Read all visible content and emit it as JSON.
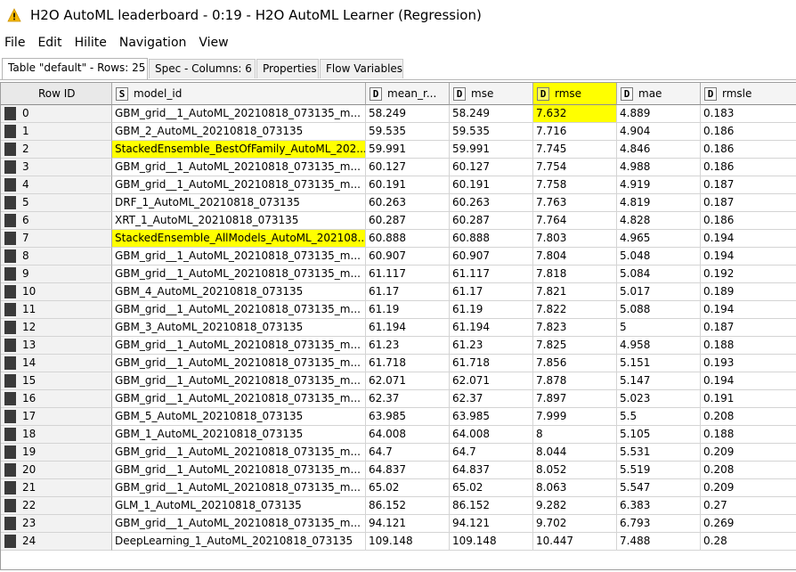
{
  "window": {
    "title": "H2O AutoML leaderboard - 0:19 - H2O AutoML Learner (Regression)",
    "icon": "warning-triangle-icon",
    "icon_color": "#f5b800"
  },
  "menu": [
    "File",
    "Edit",
    "Hilite",
    "Navigation",
    "View"
  ],
  "tabs": [
    "Table \"default\" - Rows: 25",
    "Spec - Columns: 6",
    "Properties",
    "Flow Variables"
  ],
  "highlight_color": "#ffff00",
  "table": {
    "rowid_header": "Row ID",
    "columns": [
      {
        "type": "S",
        "name": "model_id"
      },
      {
        "type": "D",
        "name": "mean_r..."
      },
      {
        "type": "D",
        "name": "mse"
      },
      {
        "type": "D",
        "name": "rmse"
      },
      {
        "type": "D",
        "name": "mae"
      },
      {
        "type": "D",
        "name": "rmsle"
      }
    ],
    "rows": [
      [
        "0",
        "GBM_grid__1_AutoML_20210818_073135_m...",
        "58.249",
        "58.249",
        "7.632",
        "4.889",
        "0.183"
      ],
      [
        "1",
        "GBM_2_AutoML_20210818_073135",
        "59.535",
        "59.535",
        "7.716",
        "4.904",
        "0.186"
      ],
      [
        "2",
        "StackedEnsemble_BestOfFamily_AutoML_202...",
        "59.991",
        "59.991",
        "7.745",
        "4.846",
        "0.186"
      ],
      [
        "3",
        "GBM_grid__1_AutoML_20210818_073135_m...",
        "60.127",
        "60.127",
        "7.754",
        "4.988",
        "0.186"
      ],
      [
        "4",
        "GBM_grid__1_AutoML_20210818_073135_m...",
        "60.191",
        "60.191",
        "7.758",
        "4.919",
        "0.187"
      ],
      [
        "5",
        "DRF_1_AutoML_20210818_073135",
        "60.263",
        "60.263",
        "7.763",
        "4.819",
        "0.187"
      ],
      [
        "6",
        "XRT_1_AutoML_20210818_073135",
        "60.287",
        "60.287",
        "7.764",
        "4.828",
        "0.186"
      ],
      [
        "7",
        "StackedEnsemble_AllModels_AutoML_202108...",
        "60.888",
        "60.888",
        "7.803",
        "4.965",
        "0.194"
      ],
      [
        "8",
        "GBM_grid__1_AutoML_20210818_073135_m...",
        "60.907",
        "60.907",
        "7.804",
        "5.048",
        "0.194"
      ],
      [
        "9",
        "GBM_grid__1_AutoML_20210818_073135_m...",
        "61.117",
        "61.117",
        "7.818",
        "5.084",
        "0.192"
      ],
      [
        "10",
        "GBM_4_AutoML_20210818_073135",
        "61.17",
        "61.17",
        "7.821",
        "5.017",
        "0.189"
      ],
      [
        "11",
        "GBM_grid__1_AutoML_20210818_073135_m...",
        "61.19",
        "61.19",
        "7.822",
        "5.088",
        "0.194"
      ],
      [
        "12",
        "GBM_3_AutoML_20210818_073135",
        "61.194",
        "61.194",
        "7.823",
        "5",
        "0.187"
      ],
      [
        "13",
        "GBM_grid__1_AutoML_20210818_073135_m...",
        "61.23",
        "61.23",
        "7.825",
        "4.958",
        "0.188"
      ],
      [
        "14",
        "GBM_grid__1_AutoML_20210818_073135_m...",
        "61.718",
        "61.718",
        "7.856",
        "5.151",
        "0.193"
      ],
      [
        "15",
        "GBM_grid__1_AutoML_20210818_073135_m...",
        "62.071",
        "62.071",
        "7.878",
        "5.147",
        "0.194"
      ],
      [
        "16",
        "GBM_grid__1_AutoML_20210818_073135_m...",
        "62.37",
        "62.37",
        "7.897",
        "5.023",
        "0.191"
      ],
      [
        "17",
        "GBM_5_AutoML_20210818_073135",
        "63.985",
        "63.985",
        "7.999",
        "5.5",
        "0.208"
      ],
      [
        "18",
        "GBM_1_AutoML_20210818_073135",
        "64.008",
        "64.008",
        "8",
        "5.105",
        "0.188"
      ],
      [
        "19",
        "GBM_grid__1_AutoML_20210818_073135_m...",
        "64.7",
        "64.7",
        "8.044",
        "5.531",
        "0.209"
      ],
      [
        "20",
        "GBM_grid__1_AutoML_20210818_073135_m...",
        "64.837",
        "64.837",
        "8.052",
        "5.519",
        "0.208"
      ],
      [
        "21",
        "GBM_grid__1_AutoML_20210818_073135_m...",
        "65.02",
        "65.02",
        "8.063",
        "5.547",
        "0.209"
      ],
      [
        "22",
        "GLM_1_AutoML_20210818_073135",
        "86.152",
        "86.152",
        "9.282",
        "6.383",
        "0.27"
      ],
      [
        "23",
        "GBM_grid__1_AutoML_20210818_073135_m...",
        "94.121",
        "94.121",
        "9.702",
        "6.793",
        "0.269"
      ],
      [
        "24",
        "DeepLearning_1_AutoML_20210818_073135",
        "109.148",
        "109.148",
        "10.447",
        "7.488",
        "0.28"
      ]
    ]
  }
}
